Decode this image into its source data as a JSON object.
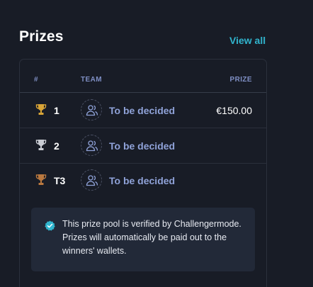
{
  "header": {
    "title": "Prizes",
    "view_all": "View all"
  },
  "table": {
    "columns": {
      "rank": "#",
      "team": "TEAM",
      "prize": "PRIZE"
    },
    "rows": [
      {
        "rank": "1",
        "team": "To be decided",
        "prize": "€150.00",
        "trophy": "gold-trophy-icon"
      },
      {
        "rank": "2",
        "team": "To be decided",
        "prize": "",
        "trophy": "silver-trophy-icon"
      },
      {
        "rank": "T3",
        "team": "To be decided",
        "prize": "",
        "trophy": "bronze-trophy-icon"
      }
    ]
  },
  "notice": {
    "text": "This prize pool is verified by Challengermode. Prizes will automatically be paid out to the winners' wallets.",
    "icon": "verified-badge-icon"
  },
  "colors": {
    "background": "#181c26",
    "accent": "#31b5ce",
    "team_link": "#8fa2d8",
    "gold": "#d8a437",
    "silver": "#c9ccd3",
    "bronze": "#b9783f"
  }
}
